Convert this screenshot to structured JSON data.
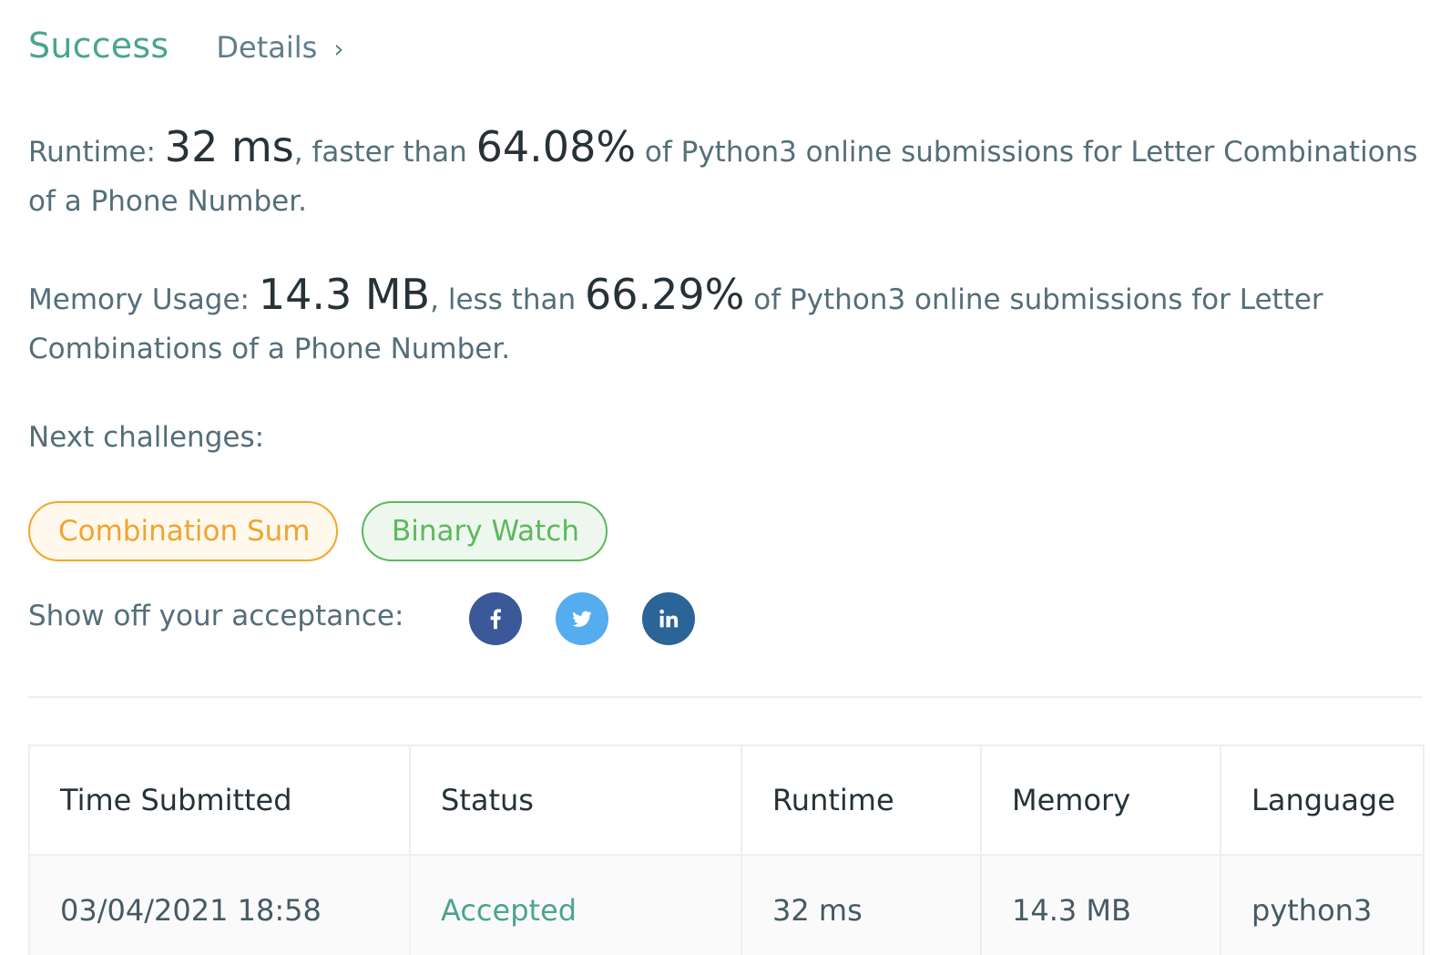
{
  "header": {
    "status": "Success",
    "details_label": "Details",
    "details_chevron": "›"
  },
  "runtime_stat": {
    "label": "Runtime:",
    "value": "32 ms",
    "comparison_prefix": ", faster than",
    "percent": "64.08%",
    "suffix": "of Python3 online submissions for Letter Combinations of a Phone Number."
  },
  "memory_stat": {
    "label": "Memory Usage:",
    "value": "14.3 MB",
    "comparison_prefix": ", less than",
    "percent": "66.29%",
    "suffix": "of Python3 online submissions for Letter Combinations of a Phone Number."
  },
  "next_challenges": {
    "label": "Next challenges:",
    "items": [
      {
        "label": "Combination Sum",
        "difficulty_color": "#f0a431"
      },
      {
        "label": "Binary Watch",
        "difficulty_color": "#5cb85c"
      }
    ]
  },
  "share": {
    "label": "Show off your acceptance:",
    "icons": [
      {
        "name": "facebook-icon",
        "color": "#3b5998"
      },
      {
        "name": "twitter-icon",
        "color": "#55acee"
      },
      {
        "name": "linkedin-icon",
        "color": "#2b6496"
      }
    ]
  },
  "submissions_table": {
    "headers": [
      "Time Submitted",
      "Status",
      "Runtime",
      "Memory",
      "Language"
    ],
    "rows": [
      {
        "time_submitted": "03/04/2021 18:58",
        "status": "Accepted",
        "runtime": "32 ms",
        "memory": "14.3 MB",
        "language": "python3"
      }
    ]
  },
  "colors": {
    "success_green": "#4aa48e",
    "text_gray": "#546e7a",
    "text_dark": "#263238"
  }
}
